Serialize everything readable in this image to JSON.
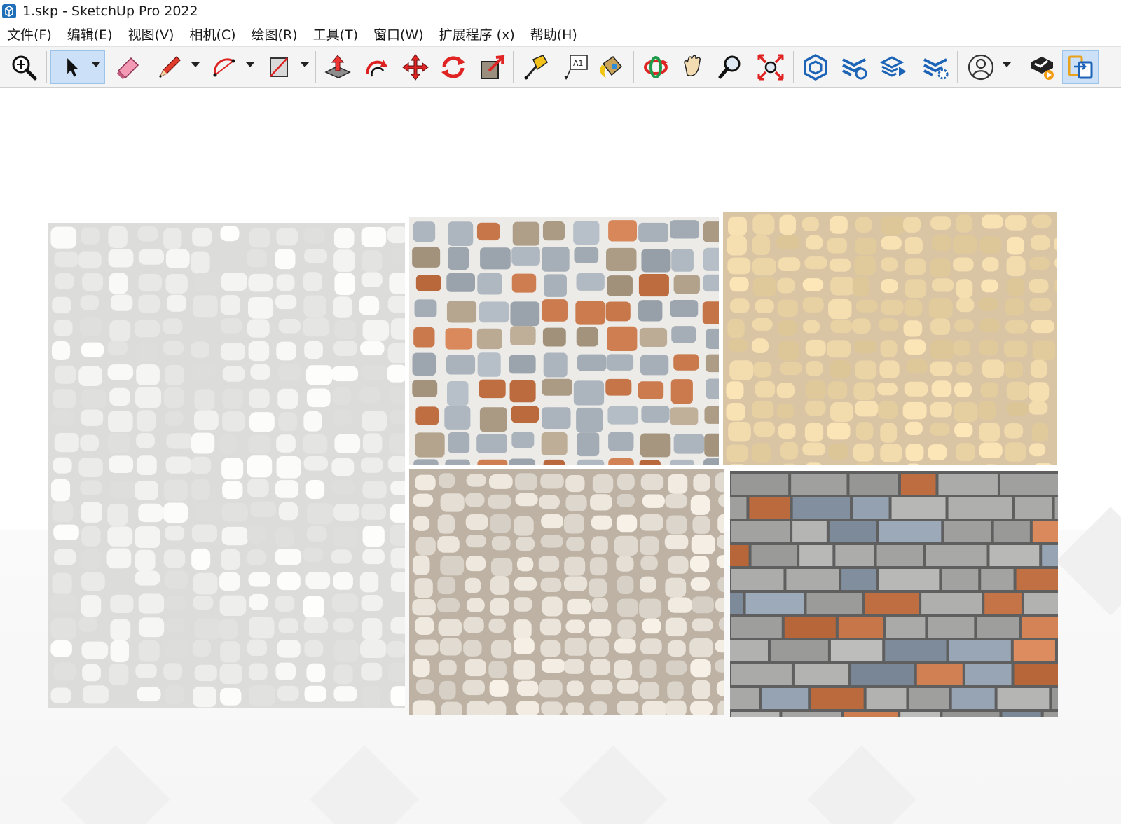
{
  "window": {
    "title": "1.skp - SketchUp Pro 2022",
    "app_icon": "sketchup-logo-icon"
  },
  "menu": [
    {
      "label": "文件(F)",
      "name": "menu-file"
    },
    {
      "label": "编辑(E)",
      "name": "menu-edit"
    },
    {
      "label": "视图(V)",
      "name": "menu-view"
    },
    {
      "label": "相机(C)",
      "name": "menu-camera"
    },
    {
      "label": "绘图(R)",
      "name": "menu-draw"
    },
    {
      "label": "工具(T)",
      "name": "menu-tools"
    },
    {
      "label": "窗口(W)",
      "name": "menu-window"
    },
    {
      "label": "扩展程序 (x)",
      "name": "menu-extensions"
    },
    {
      "label": "帮助(H)",
      "name": "menu-help"
    }
  ],
  "toolbar": {
    "tools": [
      {
        "icon": "zoom-extents-magnifier-icon"
      },
      {
        "icon": "select-arrow-icon",
        "active": true
      },
      {
        "icon": "eraser-icon"
      },
      {
        "icon": "pencil-line-icon"
      },
      {
        "icon": "arc-icon"
      },
      {
        "icon": "rectangle-icon"
      },
      {
        "icon": "push-pull-icon"
      },
      {
        "icon": "offset-icon"
      },
      {
        "icon": "move-icon"
      },
      {
        "icon": "rotate-icon"
      },
      {
        "icon": "scale-icon"
      },
      {
        "icon": "tape-measure-icon"
      },
      {
        "icon": "text-label-icon"
      },
      {
        "icon": "paint-bucket-icon"
      },
      {
        "icon": "orbit-icon"
      },
      {
        "icon": "pan-hand-icon"
      },
      {
        "icon": "zoom-icon"
      },
      {
        "icon": "zoom-extents-icon"
      },
      {
        "icon": "3d-warehouse-icon"
      },
      {
        "icon": "extension-warehouse-icon"
      },
      {
        "icon": "layout-send-icon"
      },
      {
        "icon": "extension-manager-icon"
      },
      {
        "icon": "user-account-icon"
      },
      {
        "icon": "extension-run-icon"
      },
      {
        "icon": "trimble-connect-icon"
      }
    ],
    "accent_color": "#cce0f7"
  },
  "viewport": {
    "background": "#ffffff",
    "textures": [
      {
        "name": "white-limestone-wall-texture",
        "mortar": "#dcdcda",
        "stone": "#ededeb"
      },
      {
        "name": "blue-grey-flagstone-texture",
        "mortar": "#ecebe8",
        "stone": "#a7b0b8"
      },
      {
        "name": "beige-sandstone-wall-texture",
        "mortar": "#d9c4a4",
        "stone": "#ecd6a8"
      },
      {
        "name": "cream-cobblestone-wall-texture",
        "mortar": "#bdb2a3",
        "stone": "#e7e0d6"
      },
      {
        "name": "grey-ashlar-brick-texture",
        "mortar": "#5f5f5f",
        "stone": "#a9a9a7"
      }
    ]
  }
}
